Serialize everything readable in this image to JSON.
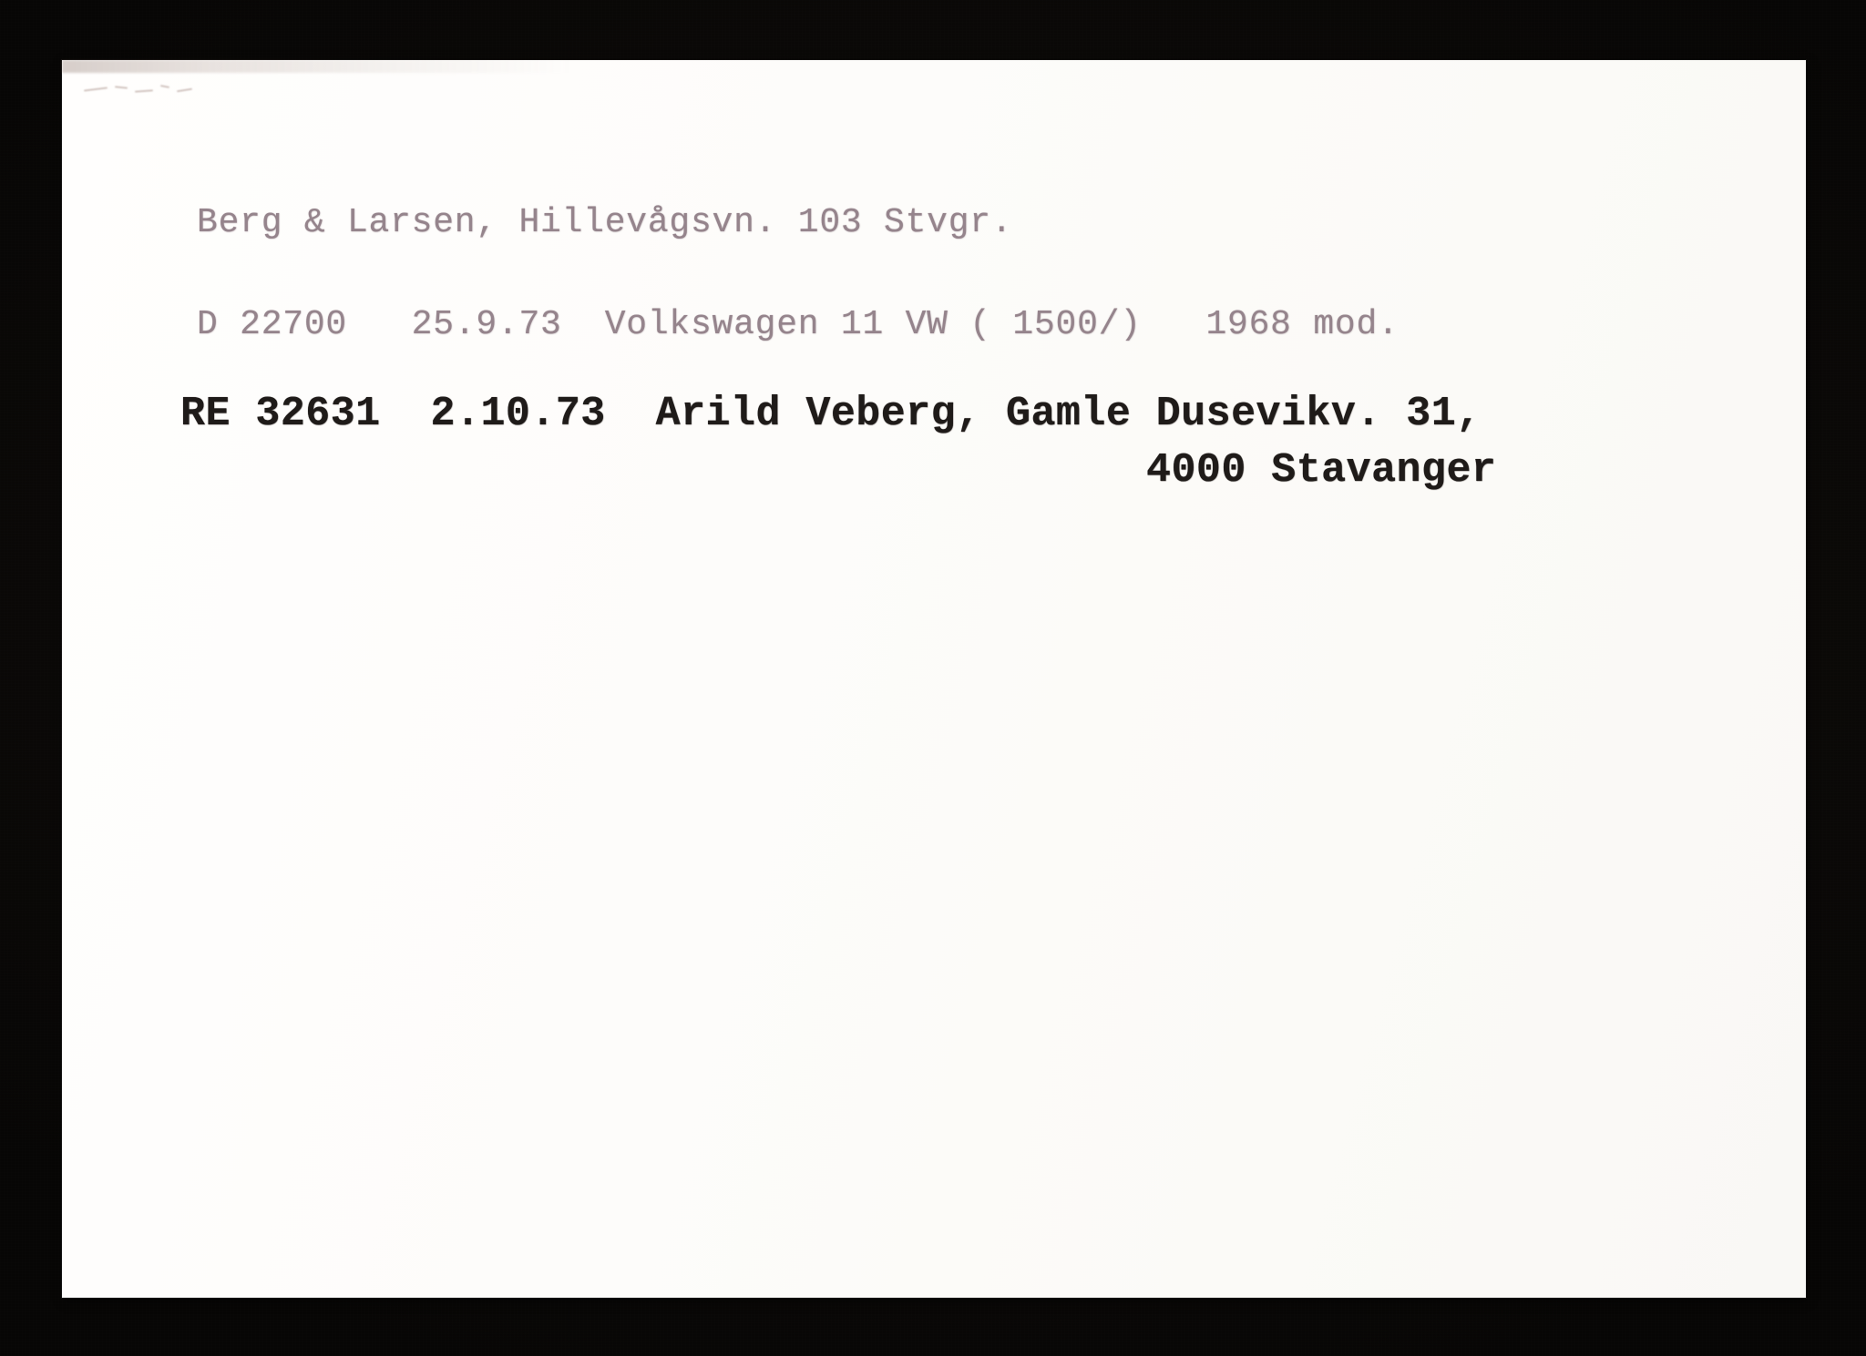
{
  "document": {
    "type": "scanned-index-card",
    "medium": "typewritten paper card",
    "background_color": "#0a0806",
    "card_color": "#fdfcfa",
    "ink_faded_color": "#8d7a83",
    "ink_dark_color": "#1f1b19"
  },
  "card": {
    "header": {
      "text": "Berg & Larsen, Hillevågsvn. 103 Stvgr.",
      "company": "Berg & Larsen",
      "street": "Hillevågsvn. 103",
      "city_abbrev": "Stvgr."
    },
    "records": [
      {
        "ink": "faded",
        "text": "D 22700   25.9.73  Volkswagen 11 VW ( 1500/)   1968 mod.",
        "plate": "D 22700",
        "date": "25.9.73",
        "vehicle": "Volkswagen 11 VW ( 1500/)",
        "model_year": "1968 mod."
      },
      {
        "ink": "dark",
        "text": "RE 32631  2.10.73  Arild Veberg, Gamle Dusevikv. 31,",
        "continuation": "4000 Stavanger",
        "plate": "RE 32631",
        "date": "2.10.73",
        "owner": "Arild Veberg",
        "street": "Gamle Dusevikv. 31,",
        "postal_code": "4000",
        "city": "Stavanger"
      }
    ]
  }
}
